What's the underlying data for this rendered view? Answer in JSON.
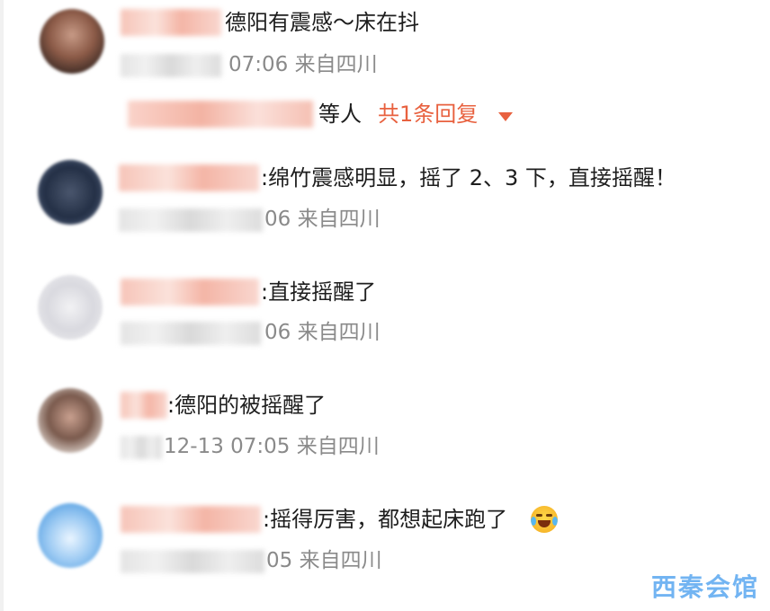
{
  "comments": [
    {
      "text": "德阳有震感～床在抖",
      "meta": "07:06 来自四川"
    },
    {
      "text": ":绵竹震感明显，摇了 2、3 下，直接摇醒！",
      "meta": "06 来自四川"
    },
    {
      "text": ":直接摇醒了",
      "meta": "06 来自四川"
    },
    {
      "text": ":德阳的被摇醒了",
      "meta": "12-13 07:05 来自四川"
    },
    {
      "text": ":摇得厉害，都想起床跑了",
      "meta": "05 来自四川"
    }
  ],
  "reply": {
    "suffix": "等人",
    "link": "共1条回复"
  },
  "watermark": "西秦会馆",
  "colors": {
    "link": "#e8613f",
    "meta": "#8a8a8a",
    "watermark": "#5aa8f0"
  },
  "icons": {
    "emoji": "laugh-cry-emoji",
    "caret": "caret-down-icon"
  }
}
